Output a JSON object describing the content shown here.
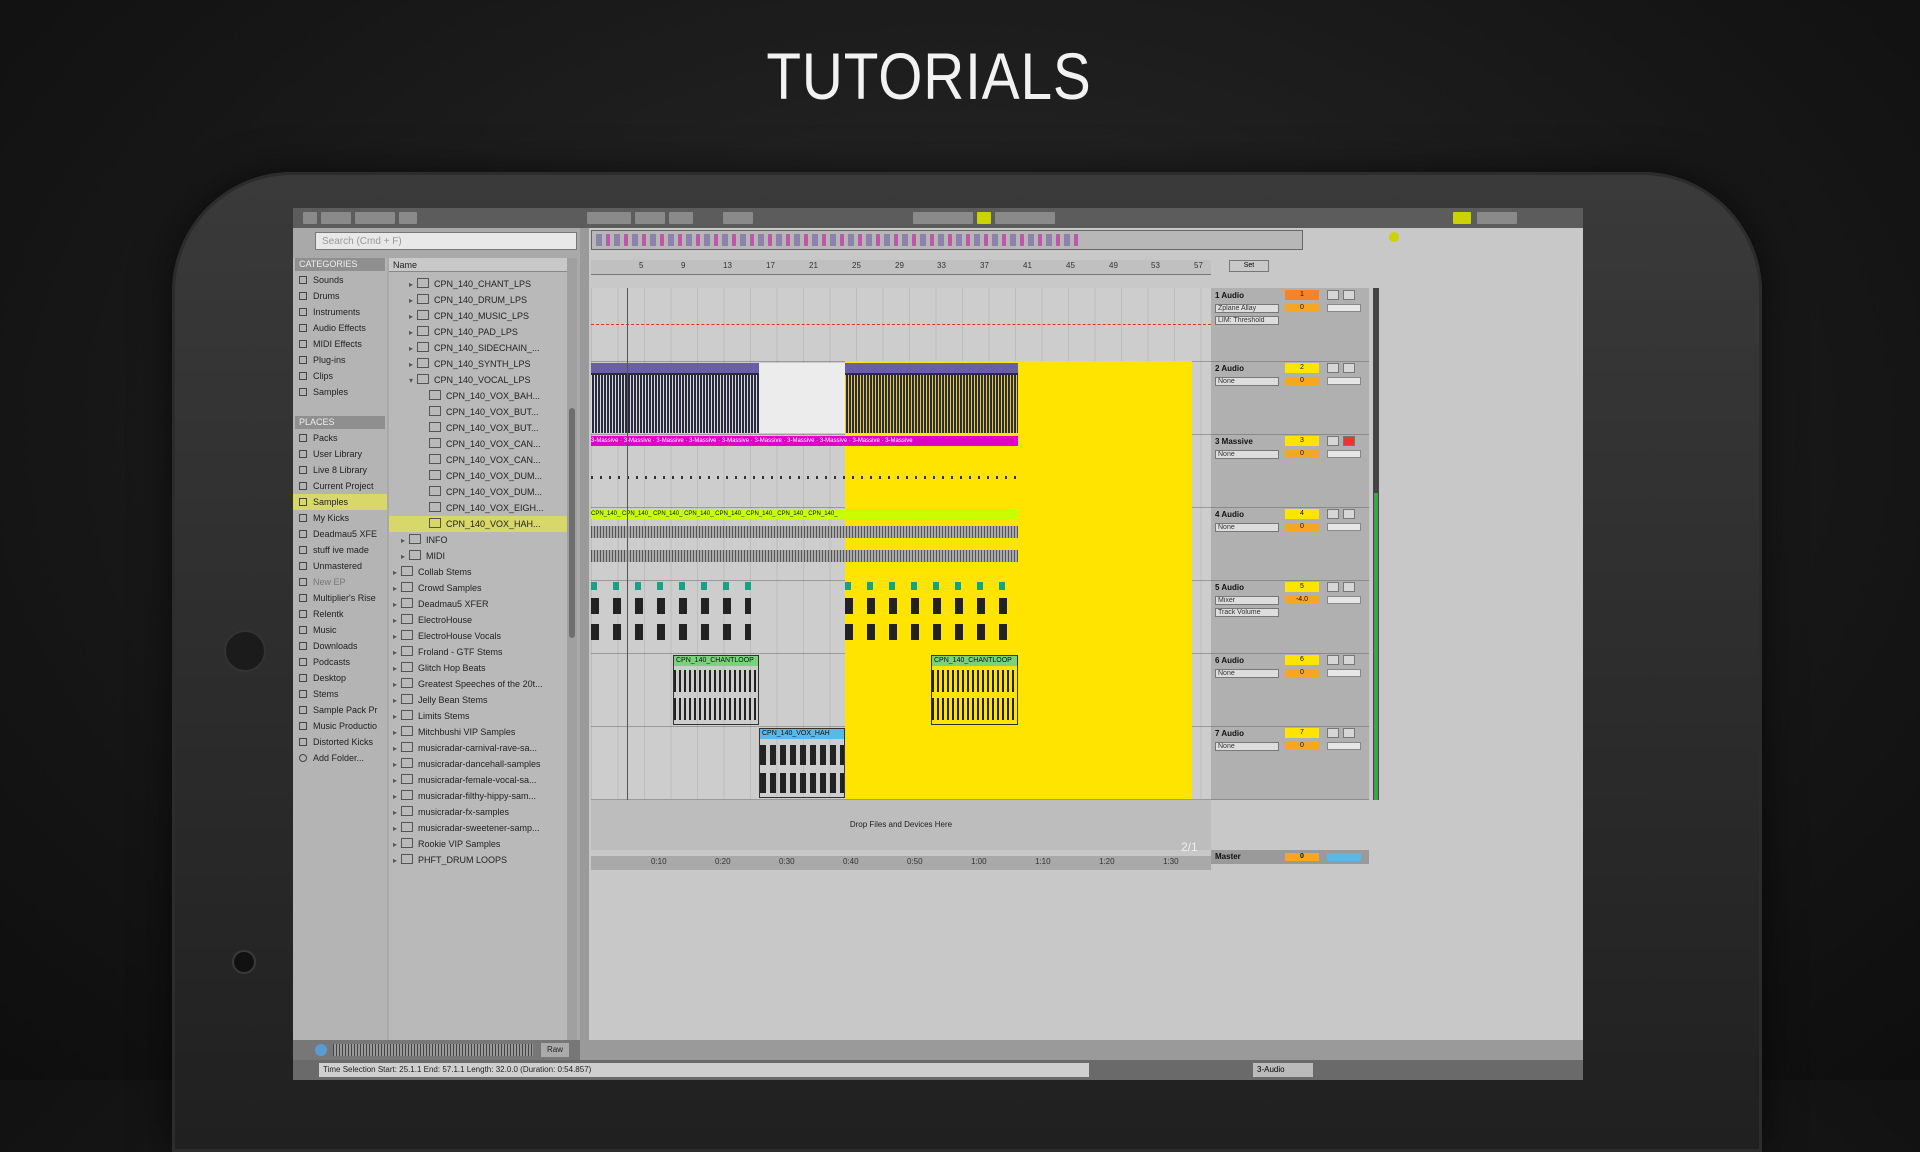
{
  "hero": {
    "title": "TUTORIALS"
  },
  "search": {
    "placeholder": "Search (Cmd + F)"
  },
  "categories": {
    "header": "CATEGORIES",
    "items": [
      "Sounds",
      "Drums",
      "Instruments",
      "Audio Effects",
      "MIDI Effects",
      "Plug-ins",
      "Clips",
      "Samples"
    ]
  },
  "places": {
    "header": "PLACES",
    "items": [
      "Packs",
      "User Library",
      "Live 8 Library",
      "Current Project",
      "Samples",
      "My Kicks",
      "Deadmau5 XFE",
      "stuff ive made",
      "Unmastered",
      "New EP",
      "Multiplier's Rise",
      "Relentk",
      "Music",
      "Downloads",
      "Podcasts",
      "Desktop",
      "Stems",
      "Sample Pack Pr",
      "Music Productio",
      "Distorted Kicks",
      "Add Folder..."
    ],
    "selected": "Samples"
  },
  "files": {
    "header": "Name",
    "folders": [
      "CPN_140_CHANT_LPS",
      "CPN_140_DRUM_LPS",
      "CPN_140_MUSIC_LPS",
      "CPN_140_PAD_LPS",
      "CPN_140_SIDECHAIN_...",
      "CPN_140_SYNTH_LPS",
      "CPN_140_VOCAL_LPS"
    ],
    "vocal_files": [
      "CPN_140_VOX_BAH...",
      "CPN_140_VOX_BUT...",
      "CPN_140_VOX_BUT...",
      "CPN_140_VOX_CAN...",
      "CPN_140_VOX_CAN...",
      "CPN_140_VOX_DUM...",
      "CPN_140_VOX_DUM...",
      "CPN_140_VOX_EIGH...",
      "CPN_140_VOX_HAH..."
    ],
    "selected_file": "CPN_140_VOX_HAH...",
    "subfolders": [
      "INFO",
      "MIDI"
    ],
    "top_folders": [
      "Collab Stems",
      "Crowd Samples",
      "Deadmau5 XFER",
      "ElectroHouse",
      "ElectroHouse Vocals",
      "Froland - GTF Stems",
      "Glitch Hop Beats",
      "Greatest Speeches of the 20t...",
      "Jelly Bean Stems",
      "Limits Stems",
      "Mitchbushi VIP Samples",
      "musicradar-carnival-rave-sa...",
      "musicradar-dancehall-samples",
      "musicradar-female-vocal-sa...",
      "musicradar-filthy-hippy-sam...",
      "musicradar-fx-samples",
      "musicradar-sweetener-samp...",
      "Rookie VIP Samples",
      "PHFT_DRUM LOOPS"
    ]
  },
  "preview": {
    "raw_label": "Raw"
  },
  "ruler": {
    "bars": [
      "5",
      "9",
      "13",
      "17",
      "21",
      "25",
      "29",
      "33",
      "37",
      "41",
      "45",
      "49",
      "53",
      "57"
    ]
  },
  "time_ruler": {
    "marks": [
      "0:10",
      "0:20",
      "0:30",
      "0:40",
      "0:50",
      "1:00",
      "1:10",
      "1:20",
      "1:30"
    ]
  },
  "set_label": "Set",
  "tracks": [
    {
      "name": "1 Audio",
      "number": "1",
      "volume": "0",
      "device": "Zplane Allay",
      "param": "LIM: Threshold"
    },
    {
      "name": "2 Audio",
      "number": "2",
      "volume": "0",
      "device": "None"
    },
    {
      "name": "3 Massive",
      "number": "3",
      "volume": "0",
      "device": "None"
    },
    {
      "name": "4 Audio",
      "number": "4",
      "volume": "0",
      "device": "None"
    },
    {
      "name": "5 Audio",
      "number": "5",
      "volume": "-4.0",
      "device": "Mixer",
      "param": "Track Volume"
    },
    {
      "name": "6 Audio",
      "number": "6",
      "volume": "0",
      "device": "None"
    },
    {
      "name": "7 Audio",
      "number": "7",
      "volume": "0",
      "device": "None"
    }
  ],
  "clips": {
    "massive": "3-Massive",
    "chant": "CPN_140_CHANTLOOP",
    "vox": "CPN_140_VOX_HAH",
    "track4": "CPN_140_"
  },
  "drop_zone": "Drop Files and Devices Here",
  "master": {
    "name": "Master",
    "volume": "0"
  },
  "zoom": "2/1",
  "status": {
    "text": "Time Selection  Start: 25.1.1  End: 57.1.1  Length: 32.0.0 (Duration: 0:54.857)"
  },
  "track_selector": "3-Audio",
  "colors": {
    "loop_region": "#ffe400",
    "selected": "#d8d86a",
    "massive_clip": "#e000c8",
    "track4_clip": "#c8ff00",
    "chant_clip": "#79d37a",
    "vox_clip": "#59b8e8"
  }
}
